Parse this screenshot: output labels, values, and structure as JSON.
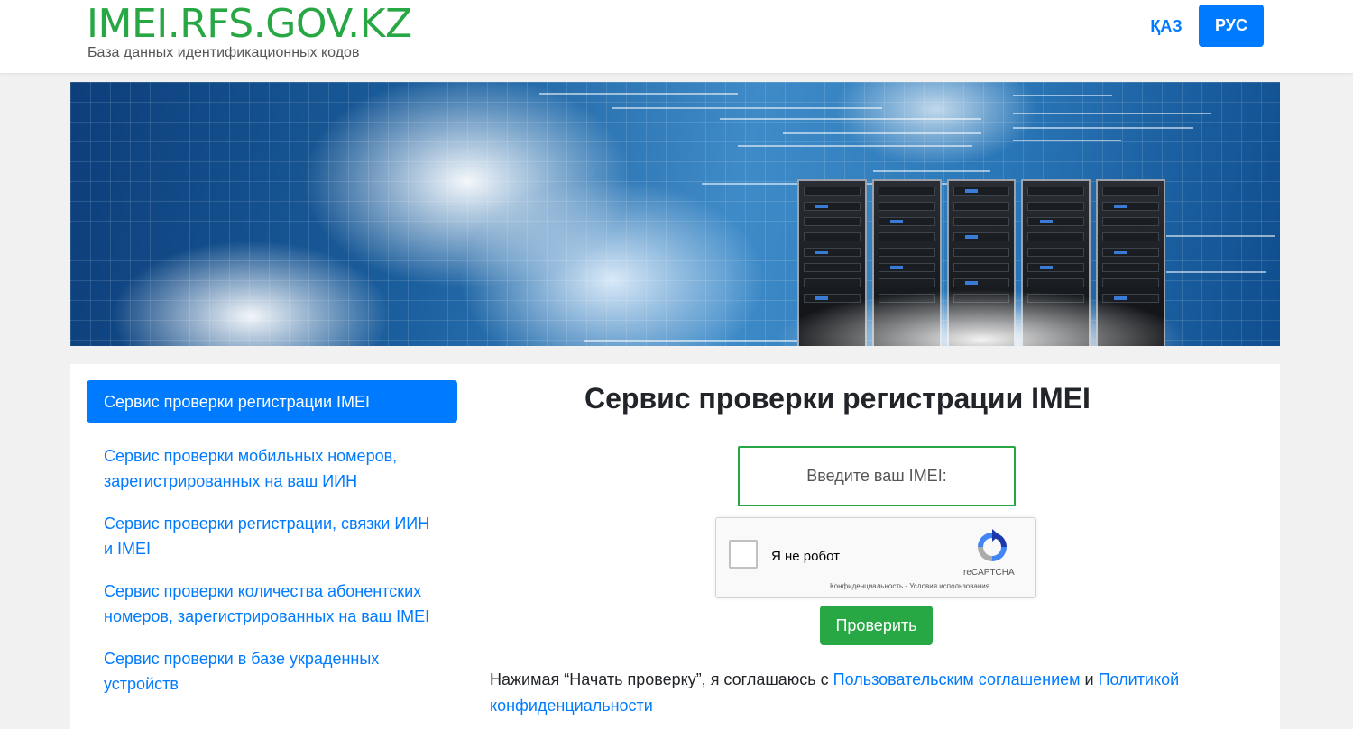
{
  "header": {
    "logo_title": "IMEI.RFS.GOV.KZ",
    "logo_subtitle": "База данных идентификационных кодов",
    "lang_kaz": "ҚАЗ",
    "lang_rus": "РУС"
  },
  "banner": {
    "image": "cloud-servers-banner"
  },
  "sidebar": {
    "items": [
      {
        "label": "Сервис проверки регистрации IMEI",
        "active": true
      },
      {
        "label": "Сервис проверки мобильных номеров, зарегистрированных на ваш ИИН",
        "active": false
      },
      {
        "label": "Сервис проверки регистрации, связки ИИН и IMEI",
        "active": false
      },
      {
        "label": "Сервис проверки количества абонентских номеров, зарегистрированных на ваш IMEI",
        "active": false
      },
      {
        "label": "Сервис проверки в базе украденных устройств",
        "active": false
      }
    ]
  },
  "main": {
    "title": "Сервис проверки регистрации IMEI",
    "imei_placeholder": "Введите ваш IMEI:",
    "imei_value": "",
    "recaptcha": {
      "label": "Я не робот",
      "brand": "reCAPTCHA",
      "terms": "Конфиденциальность - Условия использования"
    },
    "check_button": "Проверить",
    "consent": {
      "prefix": "Нажимая “Начать проверку”, я соглашаюсь с ",
      "link_agreement": "Пользовательским соглашением",
      "middle": " и ",
      "link_privacy": "Политикой конфиденциальности"
    }
  },
  "colors": {
    "brand_green": "#28a745",
    "accent_blue": "#007bff",
    "page_bg": "#f1f1f1"
  }
}
